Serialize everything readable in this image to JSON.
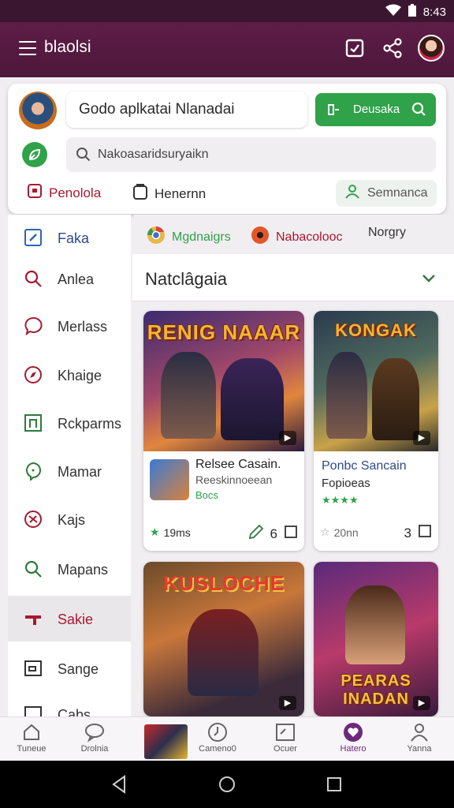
{
  "status": {
    "time": "8:43"
  },
  "appbar": {
    "title": "blaolsi"
  },
  "header_card": {
    "app_name": "Godo aplkatai Nlanadai",
    "download_label": "Deusaka",
    "search_placeholder": "Nakoasaridsuryaikn",
    "quick": [
      {
        "label": "Penolola",
        "icon": "box-icon"
      },
      {
        "label": "Henernn",
        "icon": "bag-icon"
      },
      {
        "label": "Semnanca",
        "icon": "people-icon"
      }
    ]
  },
  "sidebar": {
    "items": [
      {
        "label": "Faka",
        "icon": "edit-icon"
      },
      {
        "label": "Anlea",
        "icon": "search-icon"
      },
      {
        "label": "Merlass",
        "icon": "chat-icon"
      },
      {
        "label": "Khaige",
        "icon": "compass-icon"
      },
      {
        "label": "Rckparms",
        "icon": "square-icon"
      },
      {
        "label": "Mamar",
        "icon": "location-icon"
      },
      {
        "label": "Kajs",
        "icon": "tag-icon"
      },
      {
        "label": "Mapans",
        "icon": "search-icon"
      },
      {
        "label": "Sakie",
        "icon": "game-icon"
      },
      {
        "label": "Sange",
        "icon": "frame-icon"
      },
      {
        "label": "Cabs",
        "icon": "frame-icon"
      }
    ]
  },
  "tabs": [
    {
      "label": "Mgdnaigrs",
      "color": "#2fa24a"
    },
    {
      "label": "Nabacolooc",
      "color": "#a8192e"
    },
    {
      "label": "Norgry",
      "color": "#333333"
    }
  ],
  "section": {
    "title": "Natclâgaia"
  },
  "games": [
    {
      "art_title": "RENIG NAAAR",
      "name": "Relsee Casain.",
      "sub": "Reeskinnoeean",
      "sub2": "Bocs",
      "rating": "19ms",
      "count": "6",
      "badge": "▶"
    },
    {
      "art_title": "KONGAK",
      "name": "Ponbc Sancain",
      "sub": "Fopioeas",
      "sub2": "★★★★",
      "rating": "20nn",
      "count": "3",
      "badge": "▶"
    },
    {
      "art_title": "KUSLOCHE",
      "badge": "▶"
    },
    {
      "art_title": "PEARAS INADAN",
      "badge": "▶"
    }
  ],
  "bottom_nav": [
    {
      "label": "Tuneue",
      "icon": "home-icon"
    },
    {
      "label": "Drolnia",
      "icon": "chat-bubble-icon"
    },
    {
      "label": "Cameno0",
      "icon": "clock-icon"
    },
    {
      "label": "Ocuer",
      "icon": "image-icon"
    },
    {
      "label": "Hatero",
      "icon": "heart-icon"
    },
    {
      "label": "Yanna",
      "icon": "person-icon"
    }
  ],
  "colors": {
    "appbar": "#5e1d47",
    "accent_green": "#2fa24a",
    "accent_red": "#a8192e",
    "accent_purple": "#6d2a7c"
  }
}
